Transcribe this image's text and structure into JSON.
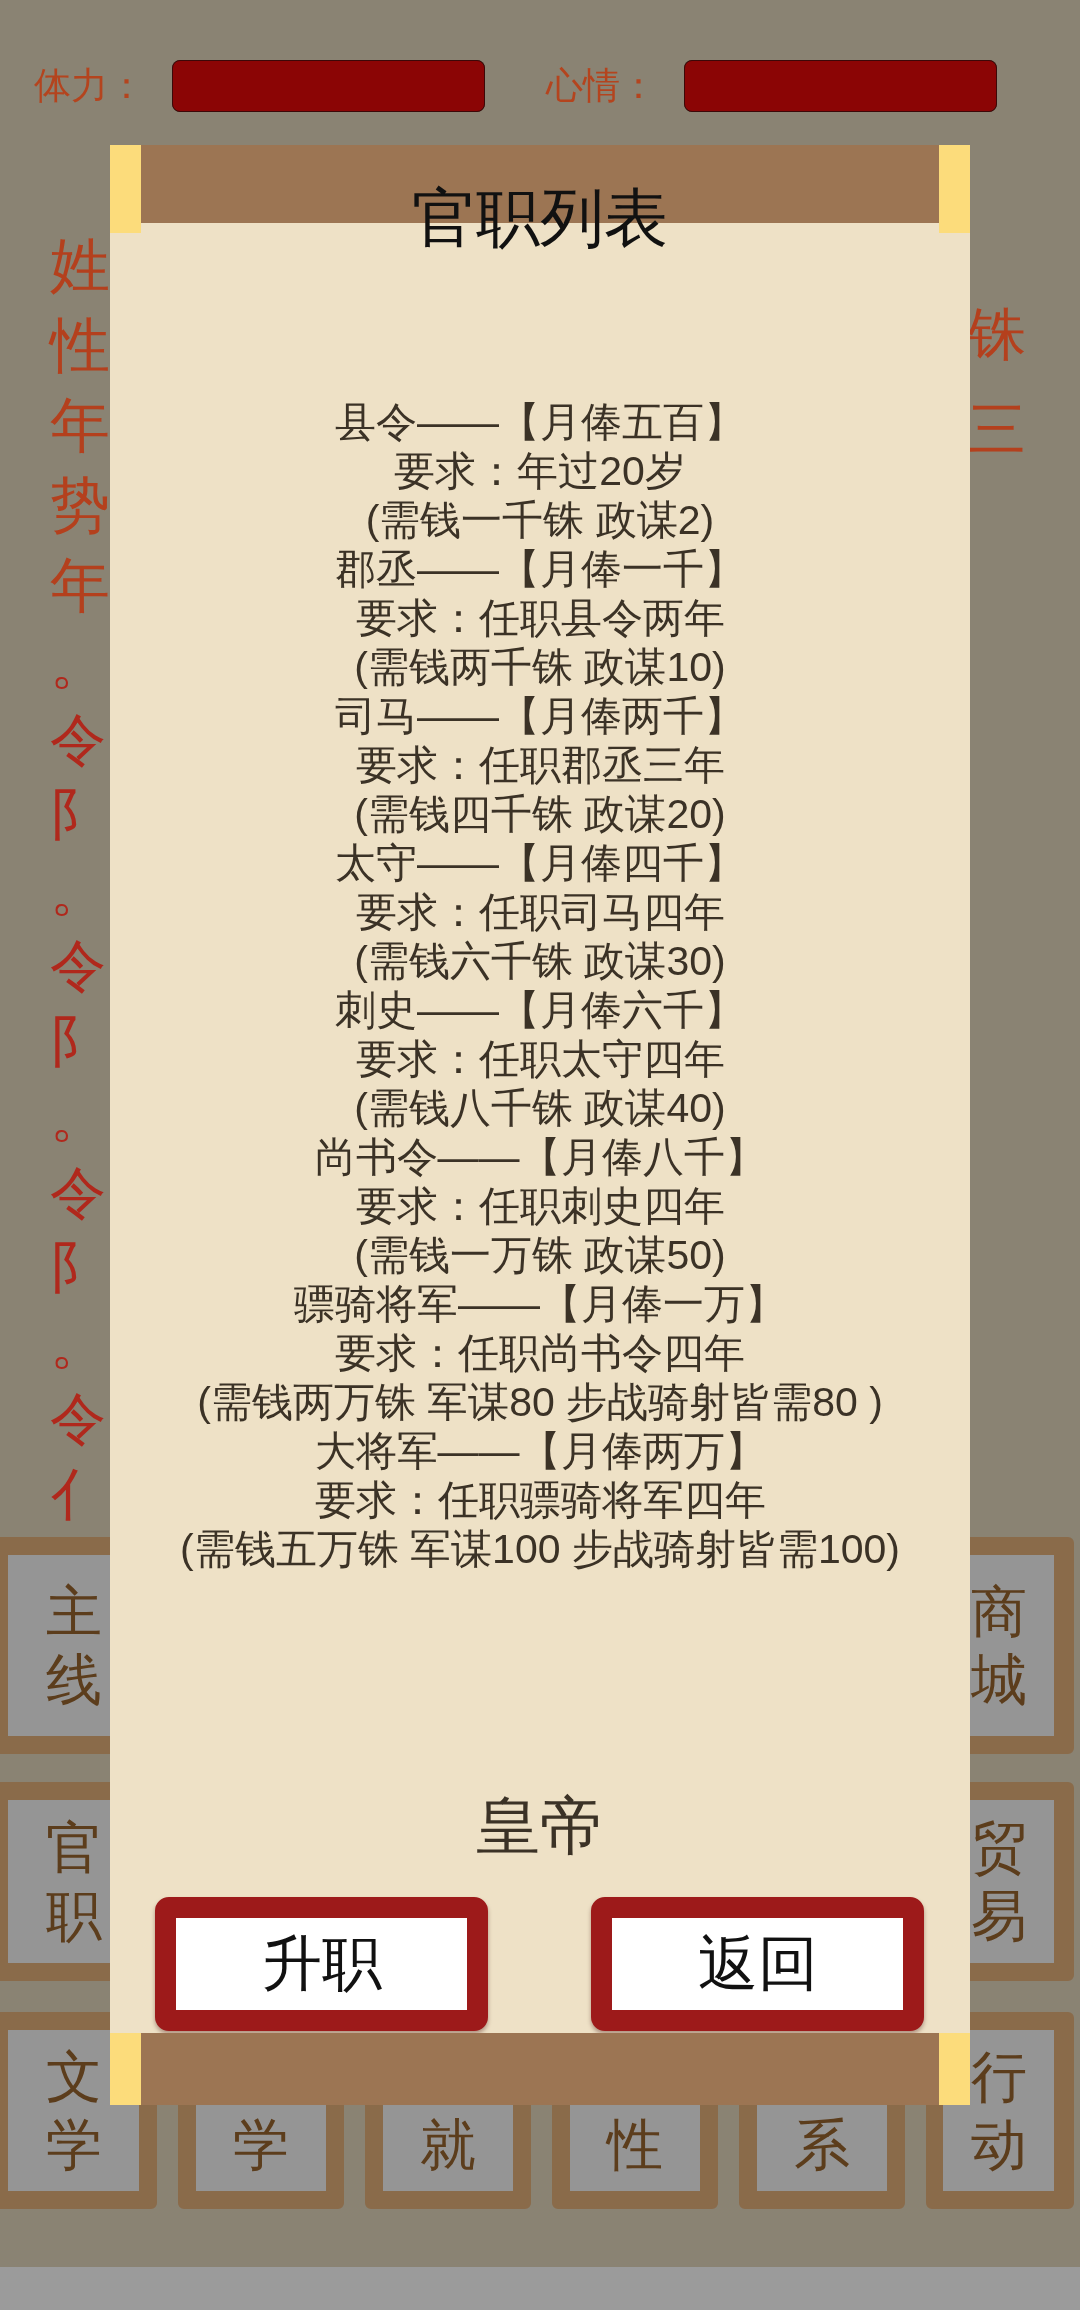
{
  "status_bars": [
    {
      "label": "体力：",
      "level": 1
    },
    {
      "label": "心情：",
      "level": 1
    }
  ],
  "left_text_lines": [
    "姓",
    "性",
    "年",
    "势",
    "年"
  ],
  "left_text_column": "。令阝。令阝。令阝。令亻",
  "right_text_lines": [
    "铢",
    "三"
  ],
  "menu_rows": [
    [
      "主线",
      "商城"
    ],
    [
      "官职",
      "贸易"
    ],
    [
      "文学",
      "学",
      "就",
      "性",
      "系",
      "行动"
    ]
  ],
  "dialog": {
    "title": "官职列表",
    "positions": [
      {
        "title": "县令——【月俸五百】",
        "requirement": "要求：年过20岁",
        "cost": "(需钱一千铢 政谋2)"
      },
      {
        "title": "郡丞——【月俸一千】",
        "requirement": "要求：任职县令两年",
        "cost": "(需钱两千铢 政谋10)"
      },
      {
        "title": "司马——【月俸两千】",
        "requirement": "要求：任职郡丞三年",
        "cost": "(需钱四千铢 政谋20)"
      },
      {
        "title": "太守——【月俸四千】",
        "requirement": "要求：任职司马四年",
        "cost": "(需钱六千铢 政谋30)"
      },
      {
        "title": "刺史——【月俸六千】",
        "requirement": "要求：任职太守四年",
        "cost": "(需钱八千铢 政谋40)"
      },
      {
        "title": "尚书令——【月俸八千】",
        "requirement": "要求：任职刺史四年",
        "cost": "(需钱一万铢 政谋50)"
      },
      {
        "title": "骠骑将军——【月俸一万】",
        "requirement": "要求：任职尚书令四年",
        "cost": "(需钱两万铢 军谋80 步战骑射皆需80 )"
      },
      {
        "title": "大将军——【月俸两万】",
        "requirement": "要求：任职骠骑将军四年",
        "cost": "(需钱五万铢 军谋100 步战骑射皆需100)"
      }
    ],
    "current_rank": "皇帝",
    "buttons": [
      "升职",
      "返回"
    ]
  }
}
